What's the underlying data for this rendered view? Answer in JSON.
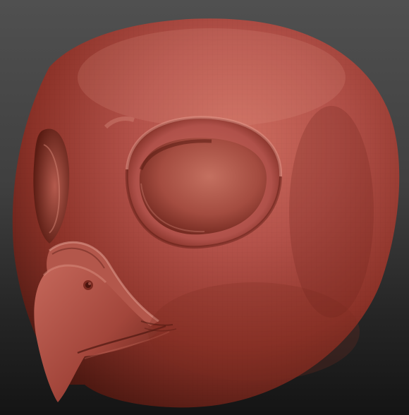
{
  "viewport": {
    "background_top": "#505050",
    "background_bottom": "#141414"
  },
  "model": {
    "icon": "owl-head-sculpt",
    "material_color": "#a8463a",
    "highlight_color": "#d9867a",
    "shadow_color": "#3e140e"
  }
}
